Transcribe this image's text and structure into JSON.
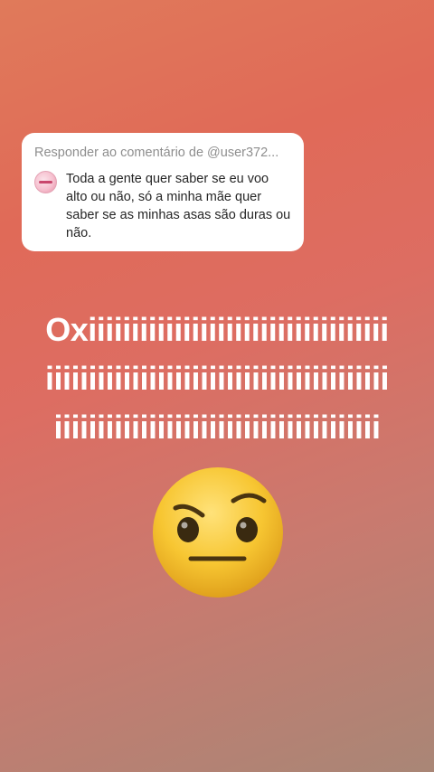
{
  "reply": {
    "header": "Responder ao comentário de @user372...",
    "comment": "Toda a gente  quer saber se eu voo alto ou não, só a minha mãe quer saber se as minhas asas  são duras ou não."
  },
  "story_text": {
    "line1": "Oxiiiiiiiiiiiiiiiiiiiiiiiiiiiiiiiiiii",
    "line2": "iiiiiiiiiiiiiiiiiiiiiiiiiiiiiiiiiiiiiiii",
    "line3": "iiiiiiiiiiiiiiiiiiiiiiiiiiiiiiiiiiiiii"
  },
  "sticker": {
    "icon": "raised-eyebrow-face-icon"
  },
  "colors": {
    "bg_top": "#e07a5a",
    "bg_bottom": "#a98676",
    "emoji_yellow": "#f7c632"
  }
}
